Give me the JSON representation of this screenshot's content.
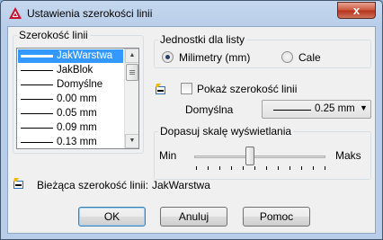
{
  "window": {
    "title": "Ustawienia szerokości linii",
    "close_glyph": "x",
    "app_icon": "autocad-logo-icon"
  },
  "lineweights": {
    "label": "Szerokość linii",
    "items": [
      {
        "label": "JakWarstwa",
        "selected": true
      },
      {
        "label": "JakBlok",
        "selected": false
      },
      {
        "label": "Domyślne",
        "selected": false
      },
      {
        "label": "0.00 mm",
        "selected": false
      },
      {
        "label": "0.05 mm",
        "selected": false
      },
      {
        "label": "0.09 mm",
        "selected": false
      },
      {
        "label": "0.13 mm",
        "selected": false
      }
    ]
  },
  "units": {
    "label": "Jednostki dla listy",
    "options": [
      {
        "label": "Milimetry (mm)",
        "selected": true
      },
      {
        "label": "Cale",
        "selected": false
      }
    ]
  },
  "display": {
    "show_label": "Pokaż szerokość linii",
    "show_checked": false,
    "icon": "lineweight-display-icon"
  },
  "default": {
    "label": "Domyślna",
    "value": "0.25 mm"
  },
  "scale": {
    "label": "Dopasuj skalę wyświetlania",
    "min_label": "Min",
    "max_label": "Maks",
    "level": 0.42
  },
  "current": {
    "label": "Bieżąca szerokość linii:",
    "value": "JakWarstwa",
    "icon": "current-lineweight-icon"
  },
  "buttons": {
    "ok": "OK",
    "cancel": "Anuluj",
    "help": "Pomoc"
  },
  "colors": {
    "selection": "#3399ff",
    "title_bar": "#b8cde9",
    "close_button": "#c9573b"
  }
}
